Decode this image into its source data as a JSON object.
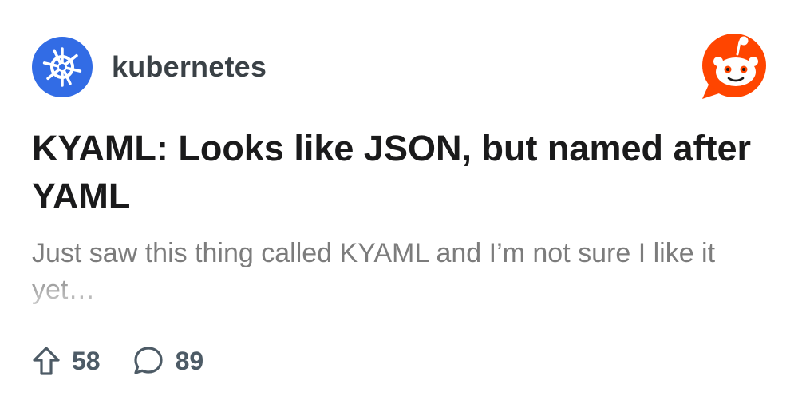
{
  "subreddit": {
    "name": "kubernetes",
    "icon": "kubernetes-helm-icon",
    "icon_color": "#326ce5"
  },
  "brand": {
    "icon": "reddit-snoo-icon",
    "color": "#ff4500"
  },
  "post": {
    "title": "KYAML: Looks like JSON, but named after YAML",
    "preview": "Just saw this thing called KYAML and I’m not sure I like it yet…"
  },
  "actions": {
    "upvotes": "58",
    "comments": "89",
    "upvote_icon": "upvote-arrow-icon",
    "comment_icon": "comment-bubble-icon"
  }
}
